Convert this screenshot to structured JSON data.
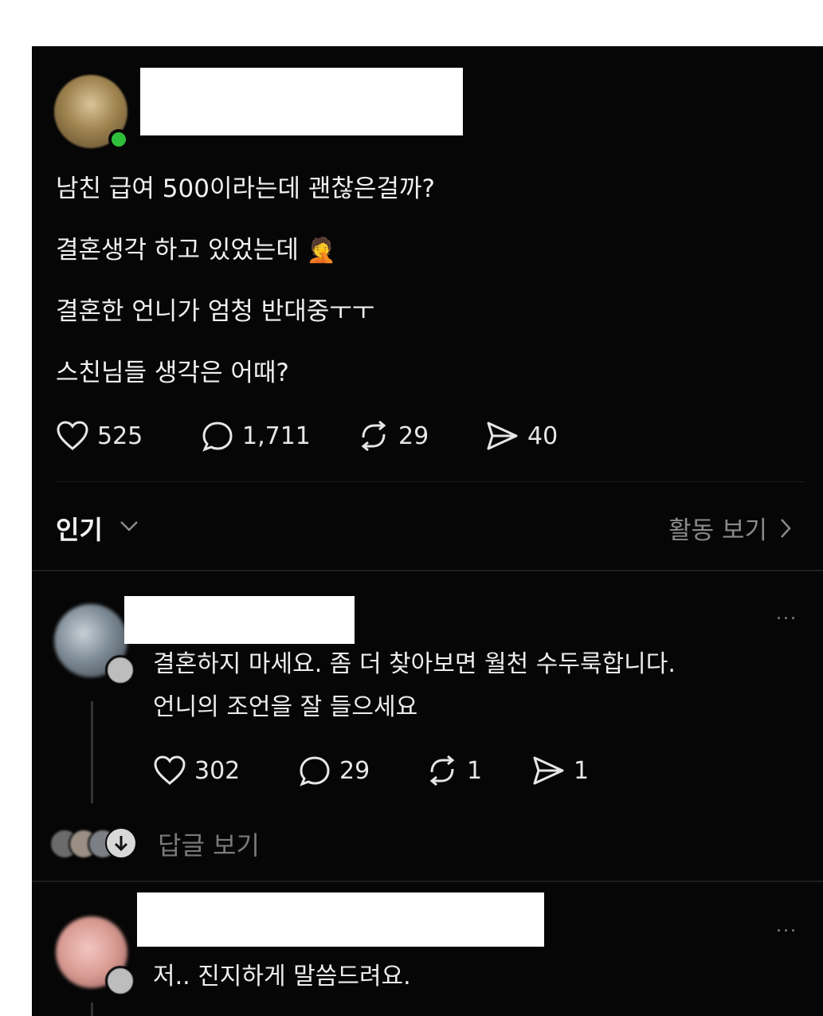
{
  "post": {
    "lines": [
      "남친 급여 500이라는데 괜찮은걸까?",
      "결혼생각 하고 있었는데",
      "결혼한 언니가 엄청 반대중ㅜㅜ",
      "스친님들 생각은 어때?"
    ],
    "emoji": "🤦",
    "stats": {
      "likes": "525",
      "comments": "1,711",
      "reposts": "29",
      "shares": "40"
    }
  },
  "sort": {
    "label": "인기",
    "activity_label": "활동 보기"
  },
  "comments": [
    {
      "lines": [
        "결혼하지 마세요. 좀 더 찾아보면 월천 수두룩합니다.",
        "언니의 조언을 잘 들으세요"
      ],
      "more": "...",
      "stats": {
        "likes": "302",
        "comments": "29",
        "reposts": "1",
        "shares": "1"
      },
      "view_replies": "답글 보기"
    },
    {
      "lines": [
        "저.. 진지하게 말씀드려요."
      ],
      "more": "..."
    }
  ],
  "icons": {
    "like": "heart-icon",
    "comment": "comment-bubble-icon",
    "repost": "repost-icon",
    "share": "send-icon",
    "sort": "chevron-down-icon",
    "activity": "chevron-right-icon",
    "replies": "arrow-down-icon"
  },
  "colors": {
    "background": "#060606",
    "online": "#2fbf3a",
    "muted": "#8a8a8a"
  }
}
